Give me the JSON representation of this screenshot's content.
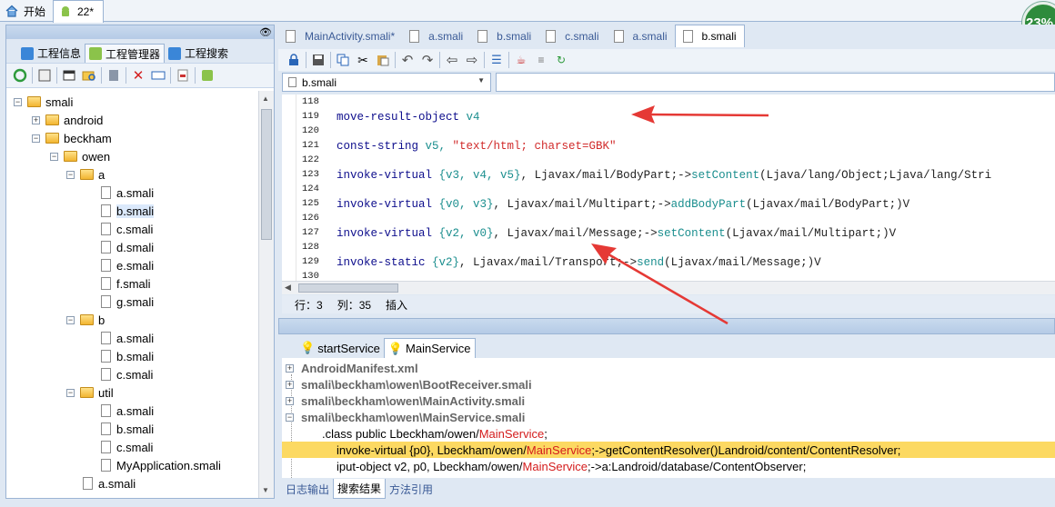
{
  "top_tabs": [
    {
      "label": "开始"
    },
    {
      "label": "22*"
    }
  ],
  "progress_badge": "23%",
  "left_panel": {
    "tabs": [
      {
        "label": "工程信息"
      },
      {
        "label": "工程管理器"
      },
      {
        "label": "工程搜索"
      }
    ],
    "tree": {
      "smali": "smali",
      "android": "android",
      "beckham": "beckham",
      "owen": "owen",
      "a": "a",
      "a_files": [
        "a.smali",
        "b.smali",
        "c.smali",
        "d.smali",
        "e.smali",
        "f.smali",
        "g.smali"
      ],
      "b": "b",
      "b_files": [
        "a.smali",
        "b.smali",
        "c.smali"
      ],
      "util": "util",
      "util_files": [
        "a.smali",
        "b.smali",
        "c.smali",
        "MyApplication.smali"
      ],
      "owen_file": "a.smali"
    }
  },
  "editor": {
    "tabs": [
      {
        "label": "MainActivity.smali*"
      },
      {
        "label": "a.smali"
      },
      {
        "label": "b.smali"
      },
      {
        "label": "c.smali"
      },
      {
        "label": "a.smali"
      },
      {
        "label": "b.smali"
      }
    ],
    "file_selector": "b.smali",
    "lines": {
      "n118": "118",
      "n119": "119",
      "t119": "move-result-object",
      "r119": " v4",
      "n120": "120",
      "n121": "121",
      "t121": "const-string",
      "r121": " v5, ",
      "s121": "\"text/html; charset=GBK\"",
      "n122": "122",
      "n123": "123",
      "t123": "invoke-virtual",
      "r123": " {v3, v4, v5}",
      "p123a": ", Ljavax/mail/BodyPart;->",
      "m123": "setContent",
      "p123b": "(Ljava/lang/Object;Ljava/lang/Stri",
      "n124": "124",
      "n125": "125",
      "t125": "invoke-virtual",
      "r125": " {v0, v3}",
      "p125a": ", Ljavax/mail/Multipart;->",
      "m125": "addBodyPart",
      "p125b": "(Ljavax/mail/BodyPart;)V",
      "n126": "126",
      "n127": "127",
      "t127": "invoke-virtual",
      "r127": " {v2, v0}",
      "p127a": ", Ljavax/mail/Message;->",
      "m127": "setContent",
      "p127b": "(Ljavax/mail/Multipart;)V",
      "n128": "128",
      "n129": "129",
      "t129": "invoke-static",
      "r129": " {v2}",
      "p129a": ", Ljavax/mail/Transport;->",
      "m129": "send",
      "p129b": "(Ljavax/mail/Message;)V",
      "n130": "130"
    },
    "status": {
      "row": "行：3",
      "col": "列：35",
      "mode": "插入"
    }
  },
  "search_panel": {
    "tabs": [
      {
        "label": "startService"
      },
      {
        "label": "MainService"
      }
    ],
    "results": {
      "r1": "AndroidManifest.xml",
      "r2": "smali\\beckham\\owen\\BootReceiver.smali",
      "r3": "smali\\beckham\\owen\\MainActivity.smali",
      "r4": "smali\\beckham\\owen\\MainService.smali",
      "m1a": ".class public Lbeckham/owen/",
      "m1b": "MainService",
      "m1c": ";",
      "m2a": "invoke-virtual {p0}, Lbeckham/owen/",
      "m2b": "MainService",
      "m2c": ";->getContentResolver()Landroid/content/ContentResolver;",
      "m3a": "iput-object v2, p0, Lbeckham/owen/",
      "m3b": "MainService",
      "m3c": ";->a:Landroid/database/ContentObserver;"
    }
  },
  "bottom_tabs": [
    {
      "label": "日志输出"
    },
    {
      "label": "搜索结果"
    },
    {
      "label": "方法引用"
    }
  ],
  "colors": {
    "highlight": "#fcd962",
    "arrow": "#e53935",
    "badge": "#2e8b3c"
  }
}
